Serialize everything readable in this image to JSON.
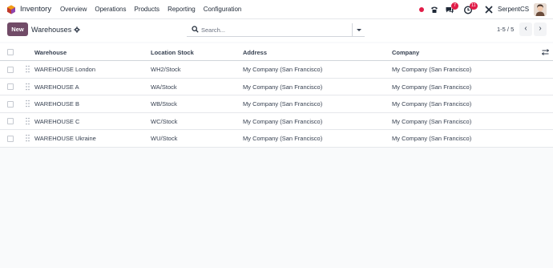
{
  "navbar": {
    "app_name": "Inventory",
    "menu": [
      "Overview",
      "Operations",
      "Products",
      "Reporting",
      "Configuration"
    ],
    "message_badge": "7",
    "activity_badge": "11",
    "company": "SerpentCS"
  },
  "control": {
    "new_label": "New",
    "breadcrumb": "Warehouses",
    "search_placeholder": "Search...",
    "pager": "1-5 / 5",
    "prev": "‹",
    "next": "›"
  },
  "table": {
    "columns": [
      "Warehouse",
      "Location Stock",
      "Address",
      "Company"
    ],
    "rows": [
      {
        "warehouse": "WAREHOUSE London",
        "location": "WH2/Stock",
        "address": "My Company (San Francisco)",
        "company": "My Company (San Francisco)"
      },
      {
        "warehouse": "WAREHOUSE A",
        "location": "WA/Stock",
        "address": "My Company (San Francisco)",
        "company": "My Company (San Francisco)"
      },
      {
        "warehouse": "WAREHOUSE B",
        "location": "WB/Stock",
        "address": "My Company (San Francisco)",
        "company": "My Company (San Francisco)"
      },
      {
        "warehouse": "WAREHOUSE C",
        "location": "WC/Stock",
        "address": "My Company (San Francisco)",
        "company": "My Company (San Francisco)"
      },
      {
        "warehouse": "WAREHOUSE Ukraine",
        "location": "WU/Stock",
        "address": "My Company (San Francisco)",
        "company": "My Company (San Francisco)"
      }
    ]
  },
  "colors": {
    "brand": "#714b67",
    "badge": "#e11d48"
  },
  "icons": [
    "inventory-logo-icon",
    "phone-icon",
    "chat-icon",
    "clock-icon",
    "tools-icon",
    "gear-icon",
    "search-icon",
    "caret-down-icon",
    "drag-handle-icon",
    "optional-columns-icon"
  ]
}
